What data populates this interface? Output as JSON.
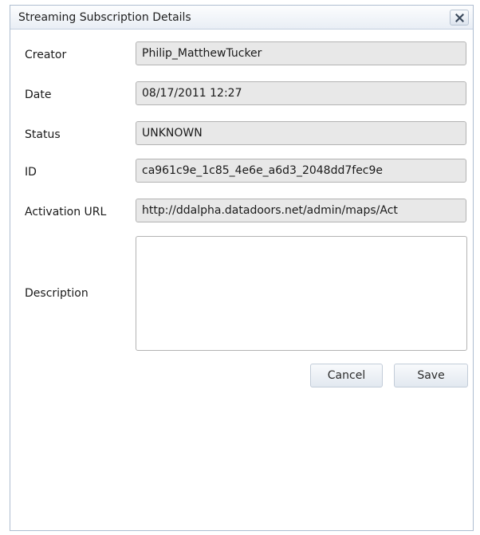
{
  "dialog": {
    "title": "Streaming Subscription Details",
    "close_icon": "close-x-icon"
  },
  "form": {
    "fields": [
      {
        "label": "Creator",
        "value": "Philip_MatthewTucker"
      },
      {
        "label": "Date",
        "value": "08/17/2011 12:27"
      },
      {
        "label": "Status",
        "value": "UNKNOWN"
      },
      {
        "label": "ID",
        "value": "ca961c9e_1c85_4e6e_a6d3_2048dd7fec9e"
      },
      {
        "label": "Activation URL",
        "value": "http://ddalpha.datadoors.net/admin/maps/Act"
      }
    ],
    "description": {
      "label": "Description",
      "value": ""
    }
  },
  "actions": {
    "cancel_label": "Cancel",
    "save_label": "Save"
  }
}
